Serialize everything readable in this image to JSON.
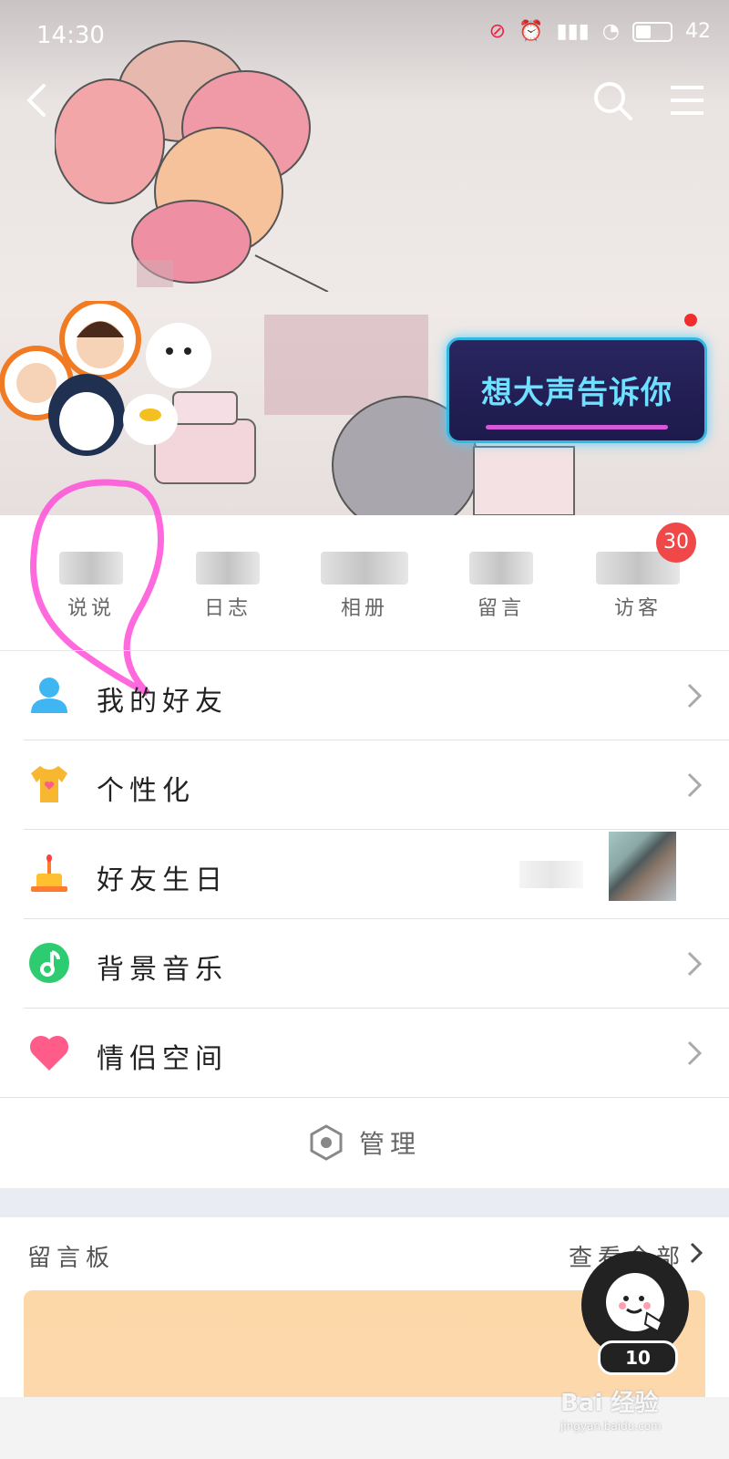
{
  "status_bar": {
    "time": "14:30",
    "battery": "42"
  },
  "nav": {
    "back_icon": "chevron-left-icon",
    "search_icon": "search-icon",
    "menu_icon": "hamburger-menu-icon"
  },
  "cover": {
    "ad_text": "想大声告诉你"
  },
  "stats": [
    {
      "label": "说说"
    },
    {
      "label": "日志"
    },
    {
      "label": "相册"
    },
    {
      "label": "留言"
    },
    {
      "label": "访客"
    }
  ],
  "visitor_badge": "30",
  "menu": [
    {
      "label": "我的好友",
      "icon": "friends-icon",
      "color": "#3fb6f2"
    },
    {
      "label": "个性化",
      "icon": "tshirt-icon",
      "color": "#f7b731"
    },
    {
      "label": "好友生日",
      "icon": "cake-icon",
      "color": "#ff9a2e"
    },
    {
      "label": "背景音乐",
      "icon": "music-note-icon",
      "color": "#2dcc70"
    },
    {
      "label": "情侣空间",
      "icon": "heart-icon",
      "color": "#ff5c8a"
    }
  ],
  "manage": {
    "label": "管理"
  },
  "message_board": {
    "title": "留言板",
    "view_all": "查看全部"
  },
  "fab": {
    "count": "10"
  },
  "watermark": {
    "brand": "Bai 经验",
    "url": "jingyan.baidu.com"
  }
}
